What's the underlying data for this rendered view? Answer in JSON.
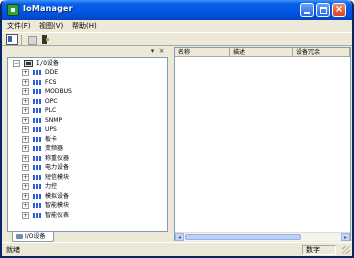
{
  "window": {
    "title": "IoManager"
  },
  "menu": [
    {
      "label": "文件(F)"
    },
    {
      "label": "视图(V)"
    },
    {
      "label": "帮助(H)"
    }
  ],
  "left_pane": {
    "controls": {
      "dock": "▾",
      "close": "×"
    },
    "tree": {
      "root": {
        "label": "I/O设备",
        "expander": "−"
      },
      "children": [
        {
          "label": "DDE"
        },
        {
          "label": "FCS"
        },
        {
          "label": "MODBUS"
        },
        {
          "label": "OPC"
        },
        {
          "label": "PLC"
        },
        {
          "label": "SNMP"
        },
        {
          "label": "UPS"
        },
        {
          "label": "板卡"
        },
        {
          "label": "变频器"
        },
        {
          "label": "称重仪器"
        },
        {
          "label": "电力设备"
        },
        {
          "label": "短信模块"
        },
        {
          "label": "力控"
        },
        {
          "label": "模拟设备"
        },
        {
          "label": "智能模块"
        },
        {
          "label": "智能仪表"
        }
      ],
      "expander_symbol": "+"
    },
    "tab": {
      "label": "I/O设备"
    }
  },
  "right_pane": {
    "columns": [
      {
        "label": "名称"
      },
      {
        "label": "描述"
      },
      {
        "label": "设备冗余"
      }
    ],
    "scroll": {
      "left": "◂",
      "right": "▸"
    }
  },
  "statusbar": {
    "text": "就绪",
    "panel": "数字"
  }
}
